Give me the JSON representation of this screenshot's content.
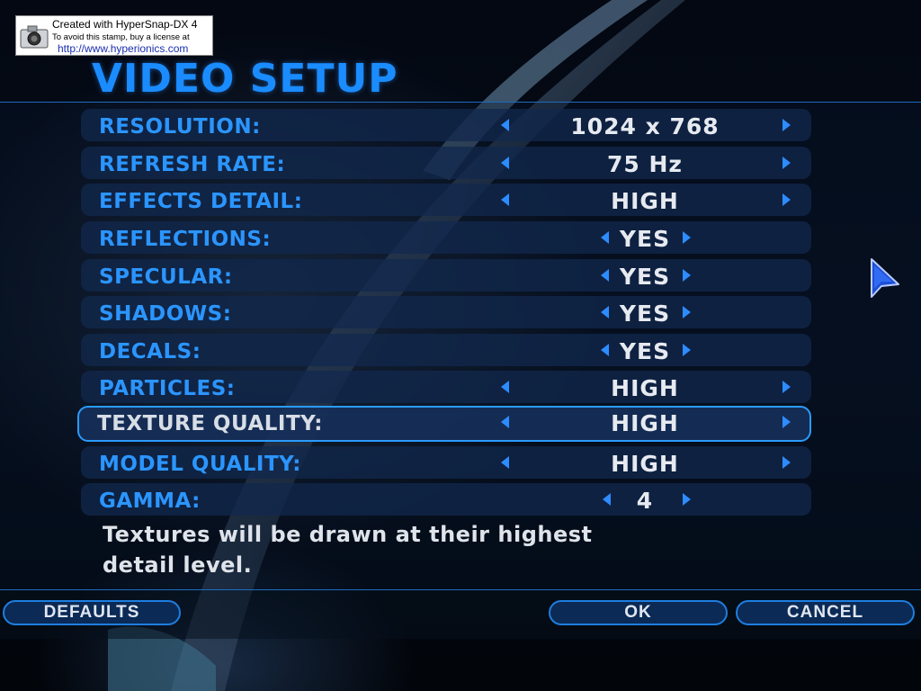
{
  "stamp": {
    "line1": "Created with HyperSnap-DX 4",
    "line2": "To avoid this stamp, buy a license at",
    "line3": "http://www.hyperionics.com"
  },
  "title": "VIDEO SETUP",
  "rows": [
    {
      "label": "RESOLUTION:",
      "value": "1024 x 768"
    },
    {
      "label": "REFRESH RATE:",
      "value": "75 Hz"
    },
    {
      "label": "EFFECTS DETAIL:",
      "value": "HIGH"
    },
    {
      "label": "REFLECTIONS:",
      "value": "YES"
    },
    {
      "label": "SPECULAR:",
      "value": "YES"
    },
    {
      "label": "SHADOWS:",
      "value": "YES"
    },
    {
      "label": "DECALS:",
      "value": "YES"
    },
    {
      "label": "PARTICLES:",
      "value": "HIGH"
    },
    {
      "label": "TEXTURE QUALITY:",
      "value": "HIGH"
    },
    {
      "label": "MODEL QUALITY:",
      "value": "HIGH"
    },
    {
      "label": "GAMMA:",
      "value": "4"
    }
  ],
  "selected_row": "TEXTURE QUALITY:",
  "description": "Textures will be drawn at their highest detail level.",
  "buttons": {
    "defaults": "DEFAULTS",
    "ok": "OK",
    "cancel": "CANCEL"
  },
  "icons": {
    "stamp": "camera-icon",
    "arrow_left": "left-arrow-icon",
    "arrow_right": "right-arrow-icon",
    "cursor": "pointer-cursor-icon"
  },
  "colors": {
    "accent": "#2b95ff",
    "value_text": "#e6eaf0",
    "selected_border": "#2a9bff",
    "button_border": "#1e7ee0"
  }
}
